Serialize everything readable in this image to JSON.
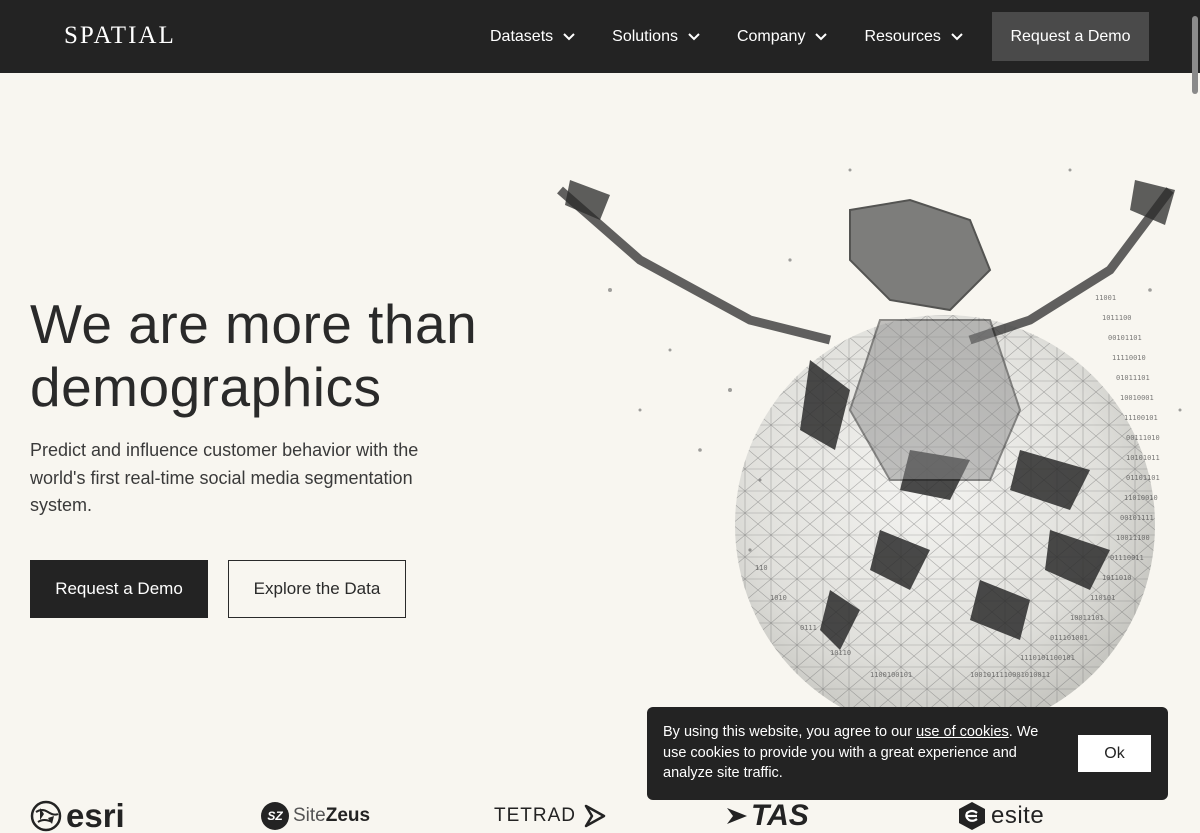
{
  "header": {
    "logo": "SPATIAL",
    "nav": [
      {
        "label": "Datasets"
      },
      {
        "label": "Solutions"
      },
      {
        "label": "Company"
      },
      {
        "label": "Resources"
      }
    ],
    "cta": "Request a Demo"
  },
  "hero": {
    "title_line1": "We are more than",
    "title_line2": "demographics",
    "subtitle": "Predict and influence customer behavior with the world's first real-time social media segmentation system.",
    "primary_button": "Request a Demo",
    "secondary_button": "Explore the Data"
  },
  "logos": {
    "esri": "esri",
    "sitezeus_mark": "SZ",
    "sitezeus_site": "Site",
    "sitezeus_zeus": "Zeus",
    "tetrad": "TETRAD",
    "tas": "TAS",
    "esite": "esite"
  },
  "cookie": {
    "text_before": "By using this website, you agree to our ",
    "link": "use of cookies",
    "text_after": ". We use cookies to provide you with a great experience and analyze site traffic.",
    "ok": "Ok"
  },
  "colors": {
    "header_bg": "#232323",
    "page_bg": "#f8f6f0",
    "nav_cta_bg": "#4a4a4a"
  }
}
